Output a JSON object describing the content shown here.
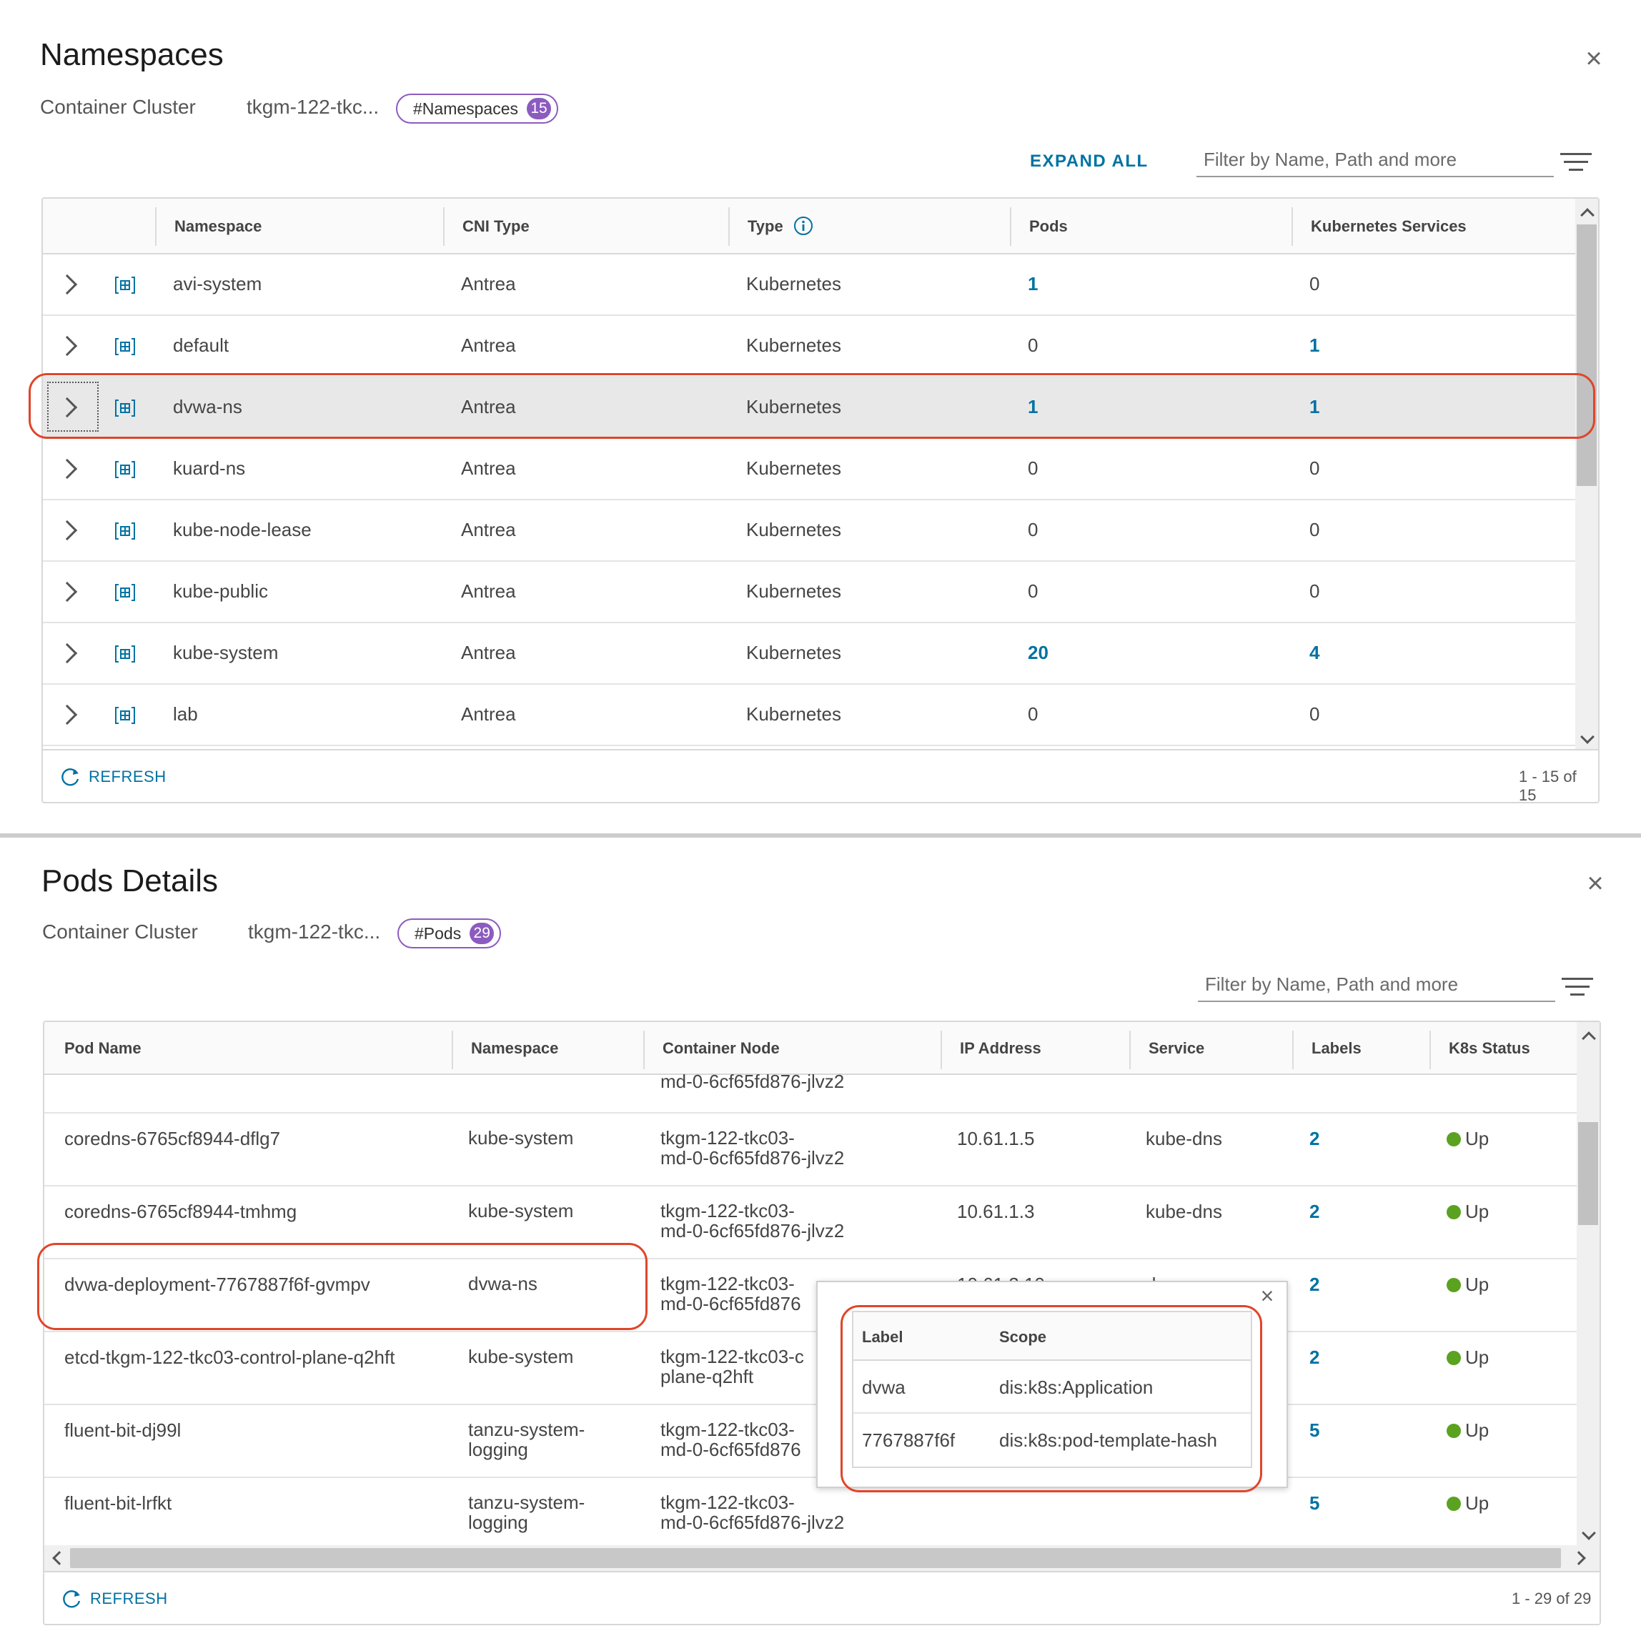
{
  "namespaces_panel": {
    "title": "Namespaces",
    "cluster_label": "Container Cluster",
    "cluster_value": "tkgm-122-tkc...",
    "badge_label": "#Namespaces",
    "badge_count": "15",
    "expand_all": "EXPAND ALL",
    "filter_placeholder": "Filter by Name, Path and more",
    "columns": [
      "Namespace",
      "CNI Type",
      "Type",
      "Pods",
      "Kubernetes Services"
    ],
    "rows": [
      {
        "namespace": "avi-system",
        "cni": "Antrea",
        "type": "Kubernetes",
        "pods": "1",
        "services": "0"
      },
      {
        "namespace": "default",
        "cni": "Antrea",
        "type": "Kubernetes",
        "pods": "0",
        "services": "1"
      },
      {
        "namespace": "dvwa-ns",
        "cni": "Antrea",
        "type": "Kubernetes",
        "pods": "1",
        "services": "1"
      },
      {
        "namespace": "kuard-ns",
        "cni": "Antrea",
        "type": "Kubernetes",
        "pods": "0",
        "services": "0"
      },
      {
        "namespace": "kube-node-lease",
        "cni": "Antrea",
        "type": "Kubernetes",
        "pods": "0",
        "services": "0"
      },
      {
        "namespace": "kube-public",
        "cni": "Antrea",
        "type": "Kubernetes",
        "pods": "0",
        "services": "0"
      },
      {
        "namespace": "kube-system",
        "cni": "Antrea",
        "type": "Kubernetes",
        "pods": "20",
        "services": "4"
      },
      {
        "namespace": "lab",
        "cni": "Antrea",
        "type": "Kubernetes",
        "pods": "0",
        "services": "0"
      }
    ],
    "refresh": "REFRESH",
    "pager": "1 - 15 of 15"
  },
  "pods_panel": {
    "title": "Pods Details",
    "cluster_label": "Container Cluster",
    "cluster_value": "tkgm-122-tkc...",
    "badge_label": "#Pods",
    "badge_count": "29",
    "filter_placeholder": "Filter by Name, Path and more",
    "columns": [
      "Pod Name",
      "Namespace",
      "Container Node",
      "IP Address",
      "Service",
      "Labels",
      "K8s Status"
    ],
    "partial_row_node": "md-0-6cf65fd876-jlvz2",
    "rows": [
      {
        "pod": "coredns-6765cf8944-dflg7",
        "namespace": [
          "kube-system",
          ""
        ],
        "node": [
          "tkgm-122-tkc03-",
          "md-0-6cf65fd876-jlvz2"
        ],
        "ip": "10.61.1.5",
        "service": "kube-dns",
        "labels": "2",
        "status": "Up"
      },
      {
        "pod": "coredns-6765cf8944-tmhmg",
        "namespace": [
          "kube-system",
          ""
        ],
        "node": [
          "tkgm-122-tkc03-",
          "md-0-6cf65fd876-jlvz2"
        ],
        "ip": "10.61.1.3",
        "service": "kube-dns",
        "labels": "2",
        "status": "Up"
      },
      {
        "pod": "dvwa-deployment-7767887f6f-gvmpv",
        "namespace": [
          "dvwa-ns",
          ""
        ],
        "node": [
          "tkgm-122-tkc03-",
          "md-0-6cf65fd876"
        ],
        "ip": "10.61.2.10",
        "service": "dvwa-svc",
        "labels": "2",
        "status": "Up"
      },
      {
        "pod": "etcd-tkgm-122-tkc03-control-plane-q2hft",
        "namespace": [
          "kube-system",
          ""
        ],
        "node": [
          "tkgm-122-tkc03-c",
          "plane-q2hft"
        ],
        "ip": "",
        "service": "",
        "labels": "2",
        "status": "Up"
      },
      {
        "pod": "fluent-bit-dj99l",
        "namespace": [
          "tanzu-system-",
          "logging"
        ],
        "node": [
          "tkgm-122-tkc03-",
          "md-0-6cf65fd876"
        ],
        "ip": "",
        "service": "",
        "labels": "5",
        "status": "Up"
      },
      {
        "pod": "fluent-bit-lrfkt",
        "namespace": [
          "tanzu-system-",
          "logging"
        ],
        "node": [
          "tkgm-122-tkc03-",
          "md-0-6cf65fd876-jlvz2"
        ],
        "ip": "",
        "service": "",
        "labels": "5",
        "status": "Up"
      }
    ],
    "labels_popover": {
      "columns": [
        "Label",
        "Scope"
      ],
      "rows": [
        {
          "label": "dvwa",
          "scope": "dis:k8s:Application"
        },
        {
          "label": "7767887f6f",
          "scope": "dis:k8s:pod-template-hash"
        }
      ]
    },
    "refresh": "REFRESH",
    "pager": "1 - 29 of 29"
  },
  "colors": {
    "link": "#0072a3",
    "badge": "#8c5bbf",
    "highlight": "#e0452a",
    "status_up": "#5aa220"
  },
  "icons": [
    "close-icon",
    "filter-icon",
    "chevron-right-icon",
    "namespace-icon",
    "info-icon",
    "refresh-icon",
    "scroll-up-icon",
    "scroll-down-icon",
    "scroll-left-icon",
    "scroll-right-icon"
  ]
}
